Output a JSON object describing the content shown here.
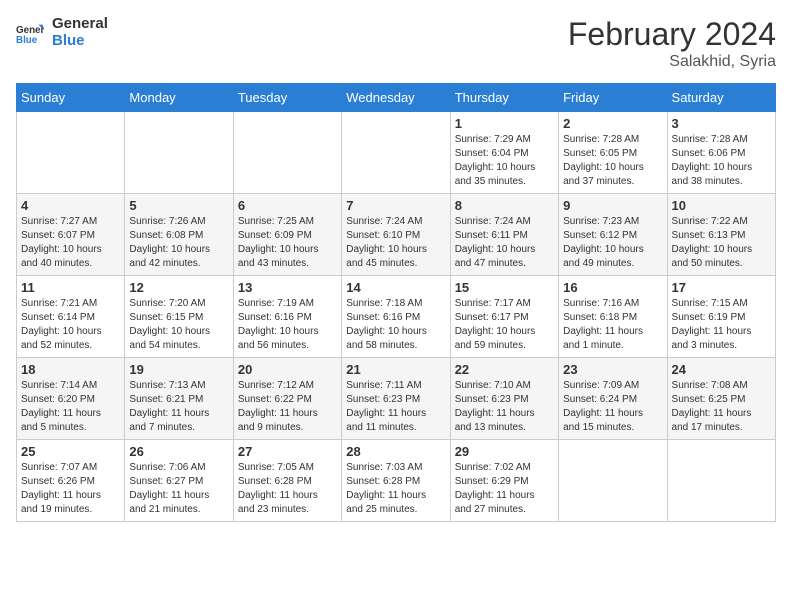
{
  "header": {
    "logo_line1": "General",
    "logo_line2": "Blue",
    "month_year": "February 2024",
    "location": "Salakhid, Syria"
  },
  "days_of_week": [
    "Sunday",
    "Monday",
    "Tuesday",
    "Wednesday",
    "Thursday",
    "Friday",
    "Saturday"
  ],
  "weeks": [
    [
      {
        "day": "",
        "info": ""
      },
      {
        "day": "",
        "info": ""
      },
      {
        "day": "",
        "info": ""
      },
      {
        "day": "",
        "info": ""
      },
      {
        "day": "1",
        "info": "Sunrise: 7:29 AM\nSunset: 6:04 PM\nDaylight: 10 hours\nand 35 minutes."
      },
      {
        "day": "2",
        "info": "Sunrise: 7:28 AM\nSunset: 6:05 PM\nDaylight: 10 hours\nand 37 minutes."
      },
      {
        "day": "3",
        "info": "Sunrise: 7:28 AM\nSunset: 6:06 PM\nDaylight: 10 hours\nand 38 minutes."
      }
    ],
    [
      {
        "day": "4",
        "info": "Sunrise: 7:27 AM\nSunset: 6:07 PM\nDaylight: 10 hours\nand 40 minutes."
      },
      {
        "day": "5",
        "info": "Sunrise: 7:26 AM\nSunset: 6:08 PM\nDaylight: 10 hours\nand 42 minutes."
      },
      {
        "day": "6",
        "info": "Sunrise: 7:25 AM\nSunset: 6:09 PM\nDaylight: 10 hours\nand 43 minutes."
      },
      {
        "day": "7",
        "info": "Sunrise: 7:24 AM\nSunset: 6:10 PM\nDaylight: 10 hours\nand 45 minutes."
      },
      {
        "day": "8",
        "info": "Sunrise: 7:24 AM\nSunset: 6:11 PM\nDaylight: 10 hours\nand 47 minutes."
      },
      {
        "day": "9",
        "info": "Sunrise: 7:23 AM\nSunset: 6:12 PM\nDaylight: 10 hours\nand 49 minutes."
      },
      {
        "day": "10",
        "info": "Sunrise: 7:22 AM\nSunset: 6:13 PM\nDaylight: 10 hours\nand 50 minutes."
      }
    ],
    [
      {
        "day": "11",
        "info": "Sunrise: 7:21 AM\nSunset: 6:14 PM\nDaylight: 10 hours\nand 52 minutes."
      },
      {
        "day": "12",
        "info": "Sunrise: 7:20 AM\nSunset: 6:15 PM\nDaylight: 10 hours\nand 54 minutes."
      },
      {
        "day": "13",
        "info": "Sunrise: 7:19 AM\nSunset: 6:16 PM\nDaylight: 10 hours\nand 56 minutes."
      },
      {
        "day": "14",
        "info": "Sunrise: 7:18 AM\nSunset: 6:16 PM\nDaylight: 10 hours\nand 58 minutes."
      },
      {
        "day": "15",
        "info": "Sunrise: 7:17 AM\nSunset: 6:17 PM\nDaylight: 10 hours\nand 59 minutes."
      },
      {
        "day": "16",
        "info": "Sunrise: 7:16 AM\nSunset: 6:18 PM\nDaylight: 11 hours\nand 1 minute."
      },
      {
        "day": "17",
        "info": "Sunrise: 7:15 AM\nSunset: 6:19 PM\nDaylight: 11 hours\nand 3 minutes."
      }
    ],
    [
      {
        "day": "18",
        "info": "Sunrise: 7:14 AM\nSunset: 6:20 PM\nDaylight: 11 hours\nand 5 minutes."
      },
      {
        "day": "19",
        "info": "Sunrise: 7:13 AM\nSunset: 6:21 PM\nDaylight: 11 hours\nand 7 minutes."
      },
      {
        "day": "20",
        "info": "Sunrise: 7:12 AM\nSunset: 6:22 PM\nDaylight: 11 hours\nand 9 minutes."
      },
      {
        "day": "21",
        "info": "Sunrise: 7:11 AM\nSunset: 6:23 PM\nDaylight: 11 hours\nand 11 minutes."
      },
      {
        "day": "22",
        "info": "Sunrise: 7:10 AM\nSunset: 6:23 PM\nDaylight: 11 hours\nand 13 minutes."
      },
      {
        "day": "23",
        "info": "Sunrise: 7:09 AM\nSunset: 6:24 PM\nDaylight: 11 hours\nand 15 minutes."
      },
      {
        "day": "24",
        "info": "Sunrise: 7:08 AM\nSunset: 6:25 PM\nDaylight: 11 hours\nand 17 minutes."
      }
    ],
    [
      {
        "day": "25",
        "info": "Sunrise: 7:07 AM\nSunset: 6:26 PM\nDaylight: 11 hours\nand 19 minutes."
      },
      {
        "day": "26",
        "info": "Sunrise: 7:06 AM\nSunset: 6:27 PM\nDaylight: 11 hours\nand 21 minutes."
      },
      {
        "day": "27",
        "info": "Sunrise: 7:05 AM\nSunset: 6:28 PM\nDaylight: 11 hours\nand 23 minutes."
      },
      {
        "day": "28",
        "info": "Sunrise: 7:03 AM\nSunset: 6:28 PM\nDaylight: 11 hours\nand 25 minutes."
      },
      {
        "day": "29",
        "info": "Sunrise: 7:02 AM\nSunset: 6:29 PM\nDaylight: 11 hours\nand 27 minutes."
      },
      {
        "day": "",
        "info": ""
      },
      {
        "day": "",
        "info": ""
      }
    ]
  ]
}
